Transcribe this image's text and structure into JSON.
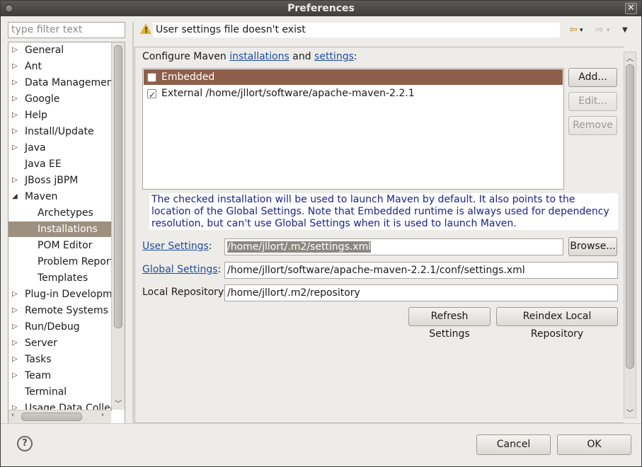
{
  "window": {
    "title": "Preferences",
    "close": "✕"
  },
  "filter": {
    "placeholder": "type filter text"
  },
  "tree": {
    "items": [
      {
        "label": "General",
        "toggle": "▷"
      },
      {
        "label": "Ant",
        "toggle": "▷"
      },
      {
        "label": "Data Management",
        "toggle": "▷"
      },
      {
        "label": "Google",
        "toggle": "▷"
      },
      {
        "label": "Help",
        "toggle": "▷"
      },
      {
        "label": "Install/Update",
        "toggle": "▷"
      },
      {
        "label": "Java",
        "toggle": "▷"
      },
      {
        "label": "Java EE",
        "toggle": ""
      },
      {
        "label": "JBoss jBPM",
        "toggle": "▷"
      },
      {
        "label": "Maven",
        "toggle": "◢"
      },
      {
        "label": "Archetypes",
        "toggle": ""
      },
      {
        "label": "Installations",
        "toggle": ""
      },
      {
        "label": "POM Editor",
        "toggle": ""
      },
      {
        "label": "Problem Reporti",
        "toggle": ""
      },
      {
        "label": "Templates",
        "toggle": ""
      },
      {
        "label": "Plug-in Developme",
        "toggle": "▷"
      },
      {
        "label": "Remote Systems",
        "toggle": "▷"
      },
      {
        "label": "Run/Debug",
        "toggle": "▷"
      },
      {
        "label": "Server",
        "toggle": "▷"
      },
      {
        "label": "Tasks",
        "toggle": "▷"
      },
      {
        "label": "Team",
        "toggle": "▷"
      },
      {
        "label": "Terminal",
        "toggle": ""
      },
      {
        "label": "Usage Data Collec",
        "toggle": "▷"
      }
    ]
  },
  "header": {
    "message": "User settings file doesn't exist",
    "back": "⇦",
    "forward": "⇨",
    "dropdown": "▾",
    "menu": "▼"
  },
  "maven": {
    "configure_prefix": "Configure Maven ",
    "installations_link": "installations",
    "and": " and ",
    "settings_link": "settings",
    "colon": ":",
    "installations": [
      {
        "label": "Embedded",
        "checked": false
      },
      {
        "label": "External /home/jllort/software/apache-maven-2.2.1",
        "checked": true
      }
    ],
    "add_label": "Add...",
    "edit_label": "Edit...",
    "remove_label": "Remove",
    "note": "The checked installation will be used to launch Maven by default. It also points to the location of the Global Settings. Note that Embedded runtime is always used for dependency resolution, but can't use Global Settings when it is used to launch Maven.",
    "user_settings_label": "User Settings",
    "user_settings_colon": ":",
    "user_settings_value": "/home/jllort/.m2/settings.xml",
    "browse_label": "Browse...",
    "global_settings_label": "Global Settings",
    "global_settings_colon": ":",
    "global_settings_value": "/home/jllort/software/apache-maven-2.2.1/conf/settings.xml",
    "local_repo_label": "Local Repository:",
    "local_repo_value": "/home/jllort/.m2/repository",
    "refresh_label": "Refresh Settings",
    "reindex_label": "Reindex Local Repository"
  },
  "footer": {
    "help": "?",
    "cancel_label": "Cancel",
    "ok_label": "OK"
  }
}
